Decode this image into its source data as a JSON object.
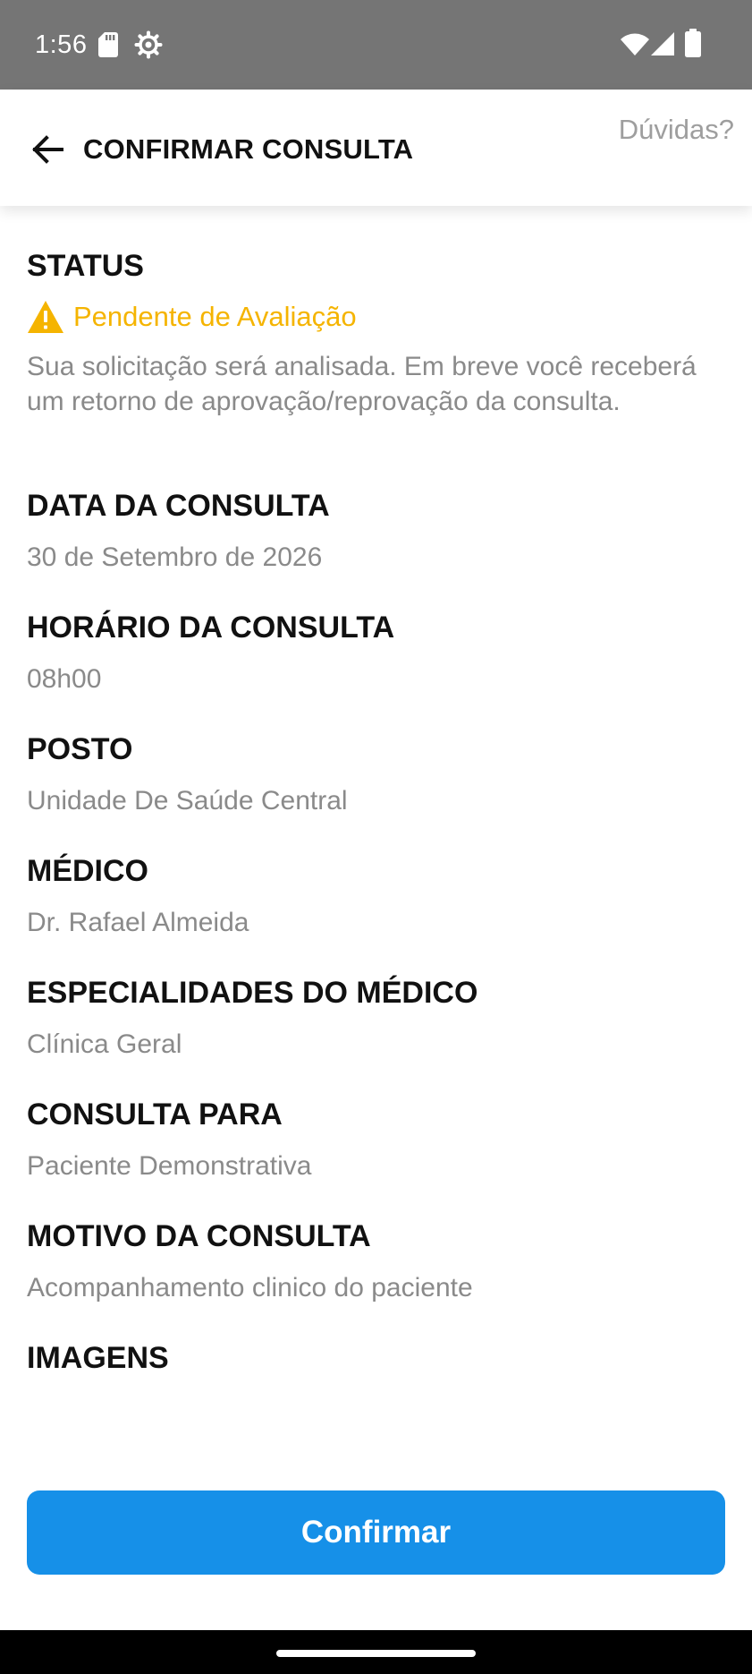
{
  "status_bar": {
    "time": "1:56",
    "icons": [
      "sd-card-icon",
      "settings-gear-icon",
      "wifi-icon",
      "signal-icon",
      "battery-icon"
    ]
  },
  "header": {
    "title": "CONFIRMAR CONSULTA",
    "help_label": "Dúvidas?",
    "back_icon": "arrow-left-icon"
  },
  "status": {
    "label": "STATUS",
    "value": "Pendente de Avaliação",
    "icon": "warning-icon",
    "description": "Sua solicitação será analisada. Em breve você receberá um retorno de aprovação/reprovação da consulta."
  },
  "fields": [
    {
      "label": "DATA DA CONSULTA",
      "value": "30 de Setembro de 2026"
    },
    {
      "label": "HORÁRIO DA CONSULTA",
      "value": "08h00"
    },
    {
      "label": "POSTO",
      "value": "Unidade De Saúde Central"
    },
    {
      "label": "MÉDICO",
      "value": "Dr. Rafael Almeida"
    },
    {
      "label": "ESPECIALIDADES DO MÉDICO",
      "value": "Clínica Geral"
    },
    {
      "label": "CONSULTA PARA",
      "value": "Paciente Demonstrativa"
    },
    {
      "label": "MOTIVO DA CONSULTA",
      "value": "Acompanhamento clinico do paciente"
    }
  ],
  "images": {
    "label": "IMAGENS"
  },
  "confirm_button": {
    "label": "Confirmar"
  },
  "colors": {
    "status_bar": "#757575",
    "accent_blue": "#1690e8",
    "warning": "#f5b400",
    "label_text": "#111111",
    "value_text": "#8a8a8a"
  }
}
